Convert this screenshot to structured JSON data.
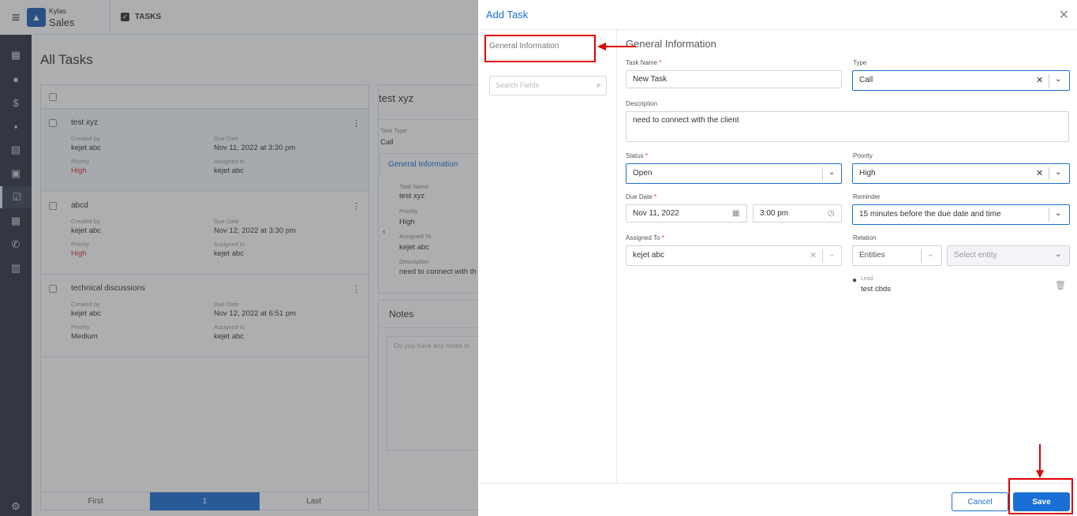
{
  "app": {
    "brand_top": "Kylas",
    "brand_bottom": "Sales",
    "module": "TASKS"
  },
  "page": {
    "title": "All Tasks"
  },
  "rail": {
    "icons": [
      "dashboard-icon",
      "contacts-icon",
      "deals-icon",
      "leads-icon",
      "companies-icon",
      "clipboard-icon",
      "tasks-icon",
      "calendar-icon",
      "phone-icon",
      "reports-icon"
    ],
    "settings_icon": "gear-icon"
  },
  "task_list": {
    "rows": [
      {
        "title": "test xyz",
        "created_by_label": "Created by",
        "created_by": "kejet abc",
        "due_label": "Due Date",
        "due": "Nov 11, 2022 at 3:30 pm",
        "priority_label": "Priority",
        "priority": "High",
        "assigned_label": "Assigned to",
        "assigned": "kejet abc"
      },
      {
        "title": "abcd",
        "created_by_label": "Created by",
        "created_by": "kejet abc",
        "due_label": "Due Date",
        "due": "Nov 12, 2022 at 3:30 pm",
        "priority_label": "Priority",
        "priority": "High",
        "assigned_label": "Assigned to",
        "assigned": "kejet abc"
      },
      {
        "title": "technical discussions",
        "created_by_label": "Created by",
        "created_by": "kejet abc",
        "due_label": "Due Date",
        "due": "Nov 12, 2022 at 6:51 pm",
        "priority_label": "Priority",
        "priority": "Medium",
        "assigned_label": "Assigned to",
        "assigned": "kejet abc"
      }
    ],
    "pager": {
      "first": "First",
      "current": "1",
      "last": "Last"
    }
  },
  "detail": {
    "title": "test xyz",
    "task_type_label": "Task Type",
    "task_type": "Call",
    "tab": "General Information",
    "fields": [
      {
        "label": "Task Name",
        "value": "test xyz"
      },
      {
        "label": "Priority",
        "value": "High"
      },
      {
        "label": "Assigned To",
        "value": "kejet abc"
      },
      {
        "label": "Description",
        "value": "need to connect with th"
      }
    ]
  },
  "notes": {
    "title": "Notes",
    "placeholder": "Do you have any notes to"
  },
  "modal": {
    "title": "Add Task",
    "side_section": "General Information",
    "search_placeholder": "Search Fields",
    "section_title": "General Information",
    "task_name": {
      "label": "Task Name",
      "value": "New Task"
    },
    "type": {
      "label": "Type",
      "value": "Call"
    },
    "description": {
      "label": "Description",
      "value": "need to connect with the client"
    },
    "status": {
      "label": "Status",
      "value": "Open"
    },
    "priority": {
      "label": "Priority",
      "value": "High"
    },
    "due_date": {
      "label": "Due Date",
      "date": "Nov 11, 2022",
      "time": "3:00 pm"
    },
    "reminder": {
      "label": "Reminder",
      "value": "15 minutes before the due date and time"
    },
    "assigned_to": {
      "label": "Assigned To",
      "value": "kejet abc"
    },
    "relation": {
      "label": "Relation",
      "entity_type": "Entities",
      "entity_placeholder": "Select entity",
      "item_type": "Lead",
      "item_name": "test cbds"
    },
    "cancel": "Cancel",
    "save": "Save"
  },
  "colors": {
    "accent": "#1a6fd6",
    "annotation": "#e00000",
    "priority_high": "#d32f2f"
  }
}
